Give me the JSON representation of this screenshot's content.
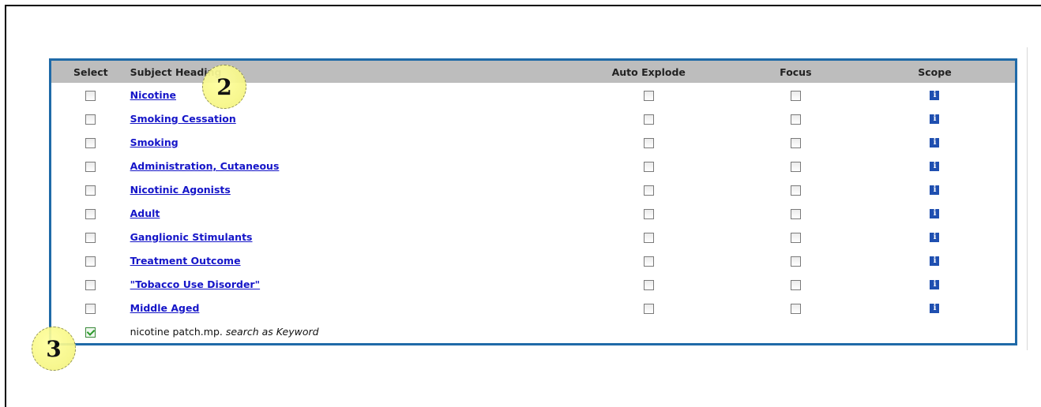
{
  "table": {
    "headers": {
      "select": "Select",
      "subject": "Subject Heading",
      "auto_explode": "Auto Explode",
      "focus": "Focus",
      "scope": "Scope"
    },
    "rows": [
      {
        "heading": "Nicotine"
      },
      {
        "heading": "Smoking Cessation"
      },
      {
        "heading": "Smoking"
      },
      {
        "heading": "Administration, Cutaneous"
      },
      {
        "heading": "Nicotinic Agonists"
      },
      {
        "heading": "Adult"
      },
      {
        "heading": "Ganglionic Stimulants"
      },
      {
        "heading": "Treatment Outcome"
      },
      {
        "heading": "\"Tobacco Use Disorder\""
      },
      {
        "heading": "Middle Aged"
      }
    ],
    "keyword_row": {
      "checked": true,
      "term": "nicotine patch.mp.",
      "suffix": "search as Keyword"
    },
    "scope_icon": "info-icon",
    "scope_glyph": "i"
  },
  "callouts": {
    "two": "2",
    "three": "3"
  },
  "colors": {
    "panel_border": "#1f6aa8",
    "header_bg": "#bdbdbd",
    "link": "#1515c8",
    "info_icon": "#1f4fb0",
    "callout": "#f3f37a"
  }
}
